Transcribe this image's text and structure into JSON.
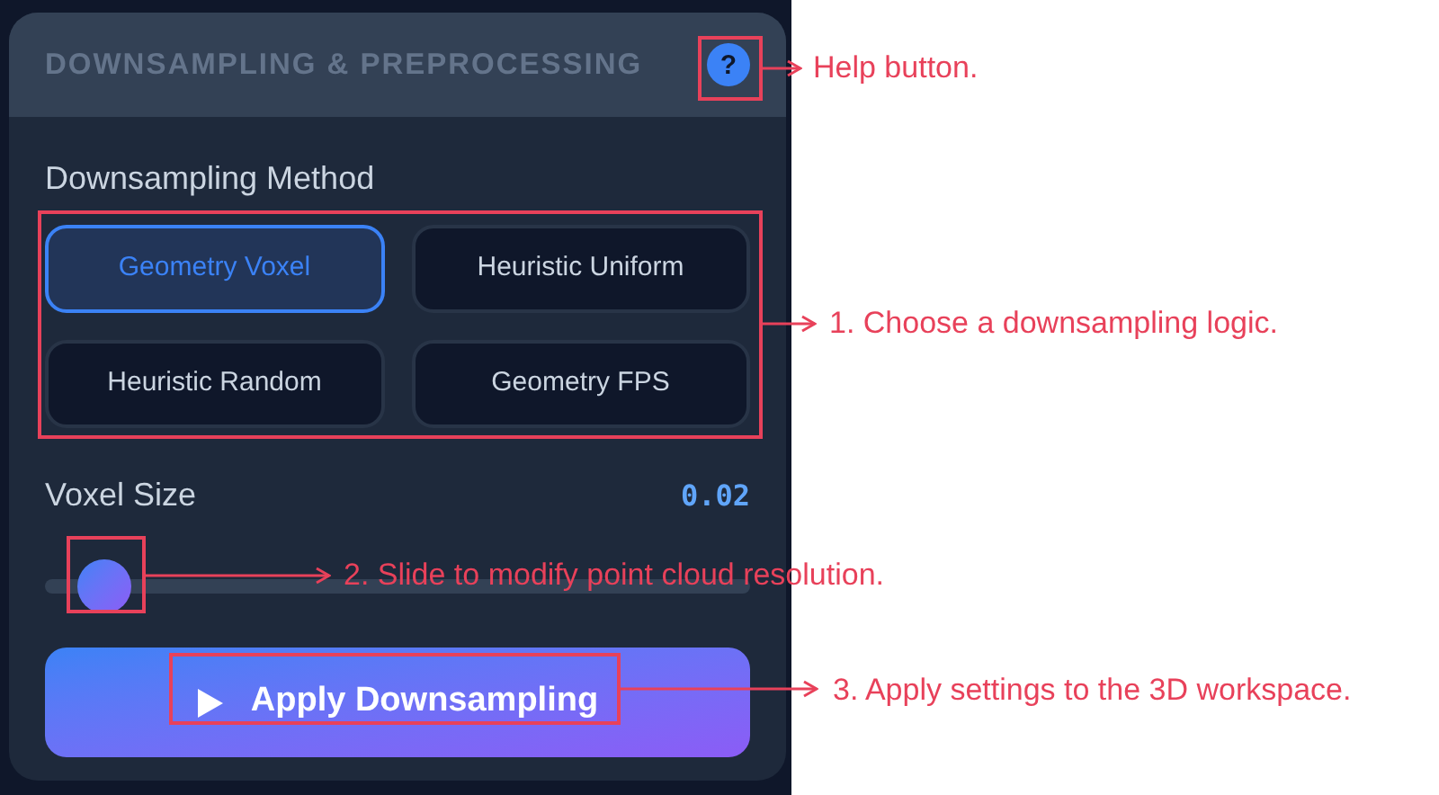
{
  "panel": {
    "title": "DOWNSAMPLING & PREPROCESSING",
    "help_button": "?"
  },
  "method_section": {
    "label": "Downsampling Method",
    "methods": [
      {
        "label": "Geometry Voxel",
        "selected": true
      },
      {
        "label": "Heuristic Uniform",
        "selected": false
      },
      {
        "label": "Heuristic Random",
        "selected": false
      },
      {
        "label": "Geometry FPS",
        "selected": false
      }
    ]
  },
  "voxel_size": {
    "label": "Voxel Size",
    "value": "0.02",
    "level": 0.05
  },
  "apply_button": {
    "label": "Apply Downsampling"
  },
  "annotations": [
    {
      "text": "Help button."
    },
    {
      "text": "1. Choose a downsampling logic."
    },
    {
      "text": "2. Slide to modify point cloud resolution."
    },
    {
      "text": "3. Apply settings to the 3D workspace."
    }
  ]
}
